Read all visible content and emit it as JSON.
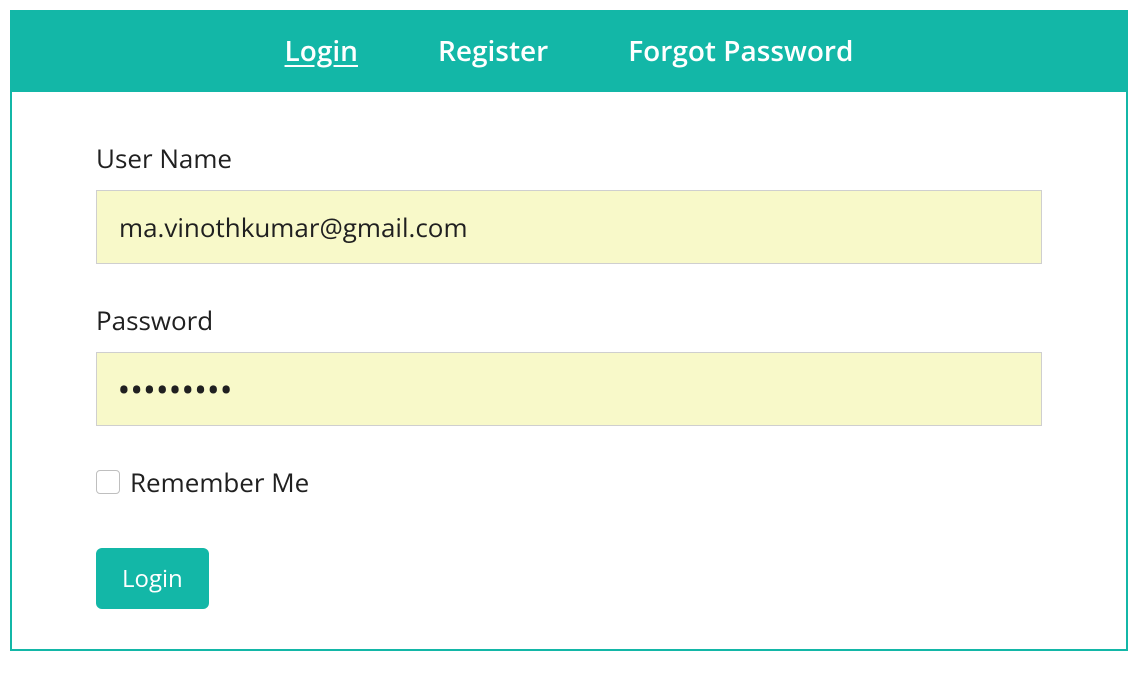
{
  "colors": {
    "accent": "#13b7a7",
    "input_bg": "#f8f9c9"
  },
  "tabs": {
    "login": "Login",
    "register": "Register",
    "forgot": "Forgot Password"
  },
  "form": {
    "username_label": "User Name",
    "username_value": "ma.vinothkumar@gmail.com",
    "password_label": "Password",
    "password_value": "•••••••••",
    "remember_label": "Remember Me",
    "remember_checked": false,
    "submit_label": "Login"
  }
}
